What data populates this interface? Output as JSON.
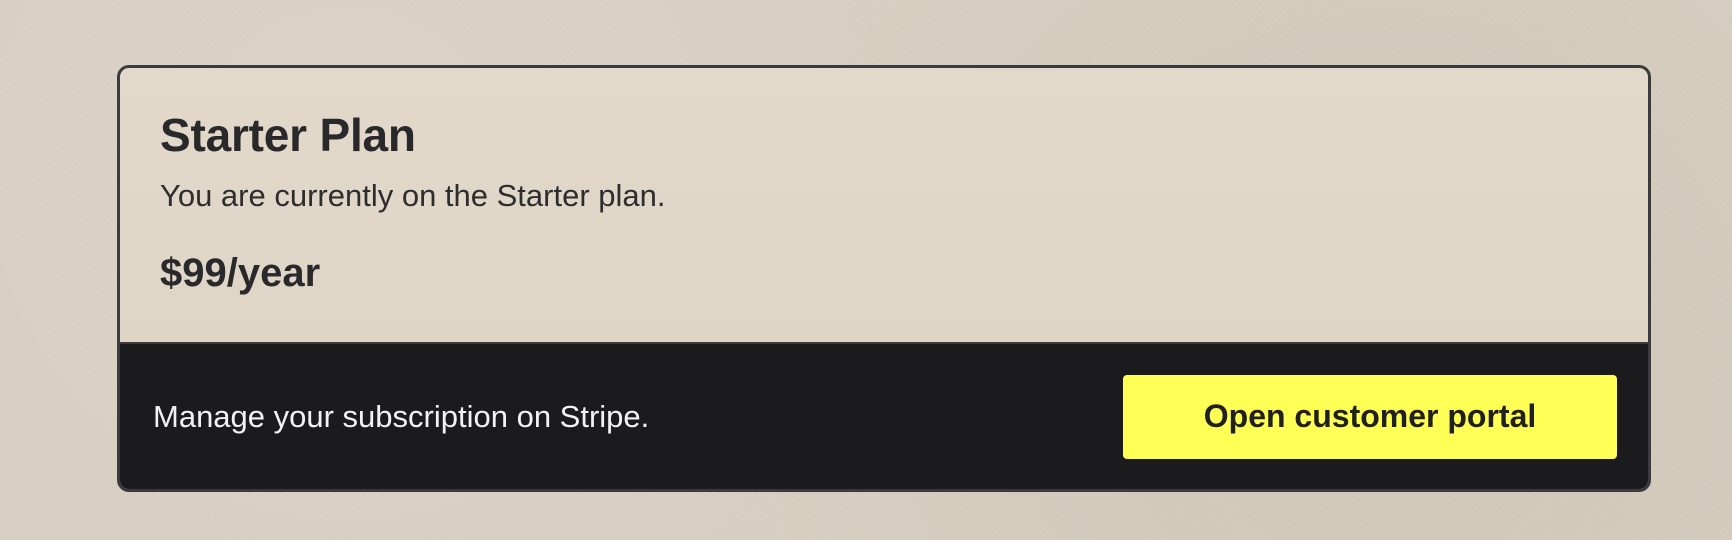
{
  "plan": {
    "title": "Starter Plan",
    "description": "You are currently on the Starter plan.",
    "price": "$99/year"
  },
  "footer": {
    "manage_text": "Manage your subscription on Stripe.",
    "portal_button_label": "Open customer portal"
  },
  "colors": {
    "page_background": "#d8cfc1",
    "card_border": "#3b3b3f",
    "footer_background": "#1b1b1d",
    "button_accent": "#ffff55"
  }
}
